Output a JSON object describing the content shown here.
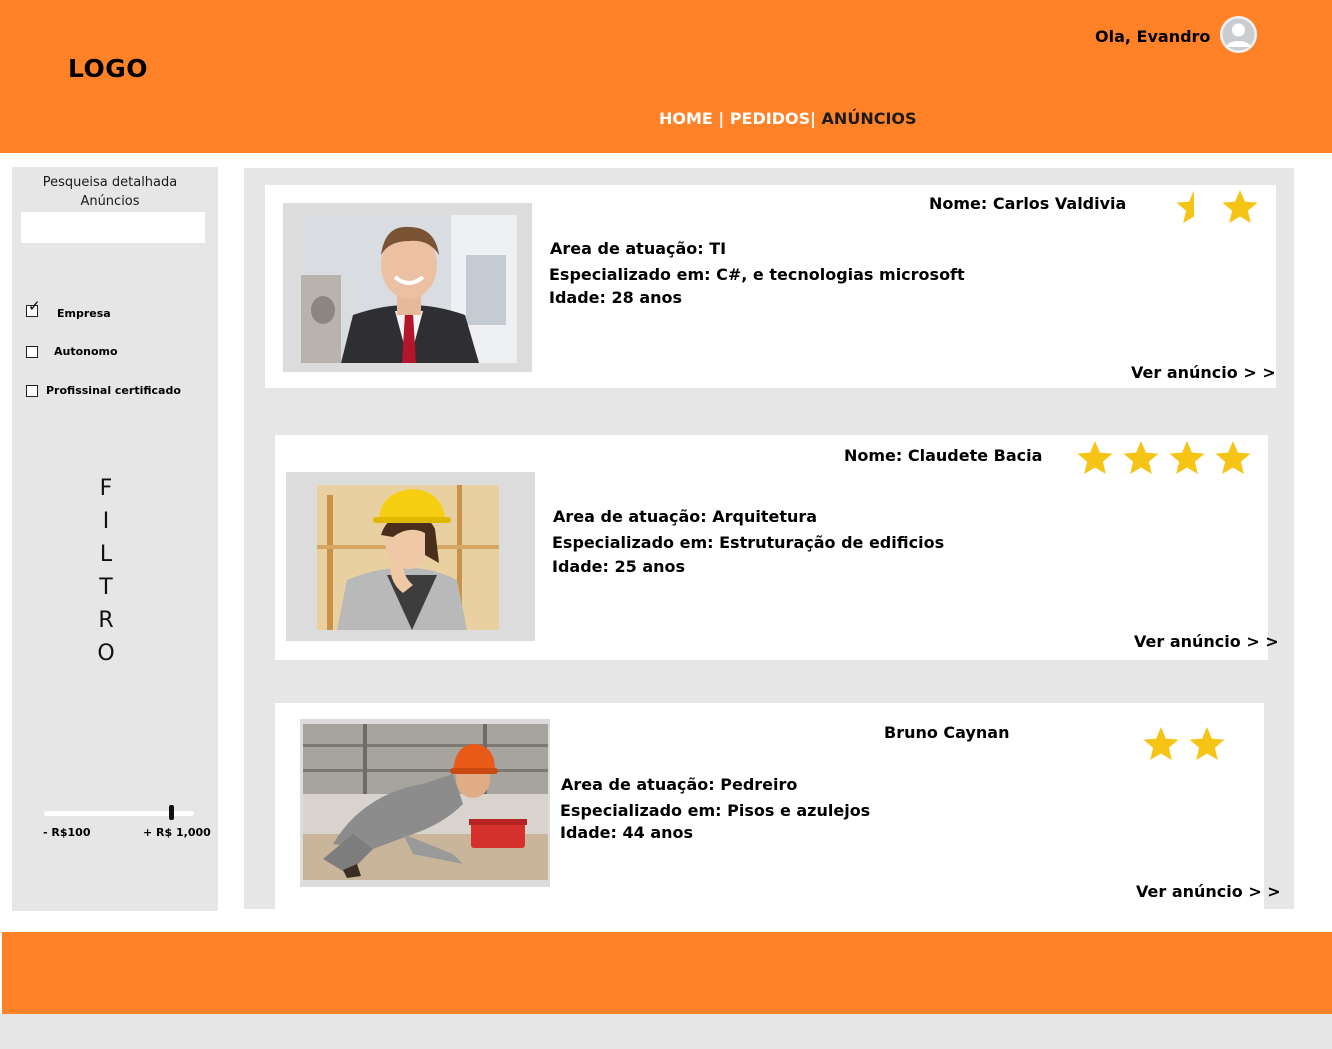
{
  "colors": {
    "brand": "#ff8228",
    "panel": "#e6e6e6",
    "star": "#f6c415",
    "active_nav": "#1a1a1a"
  },
  "header": {
    "logo": "LOGO",
    "greeting": "Ola, Evandro",
    "nav": {
      "home": "HOME",
      "sep1": " | ",
      "pedidos": "PEDIDOS",
      "sep2": "| ",
      "anuncios": "ANÚNCIOS",
      "active": "anuncios"
    }
  },
  "sidebar": {
    "title_line1": "Pesqueisa detalhada",
    "title_line2": "Anúncios",
    "search_value": "",
    "checkboxes": [
      {
        "label": "Empresa",
        "checked": true
      },
      {
        "label": "Autonomo",
        "checked": false
      },
      {
        "label": "Profissinal certificado",
        "checked": false
      }
    ],
    "filter_letters": [
      "F",
      "I",
      "L",
      "T",
      "R",
      "O"
    ],
    "price_min": "- R$100",
    "price_max": "+ R$ 1,000",
    "slider_value": 0.85
  },
  "listings": [
    {
      "name_label": "Nome:",
      "name": "Carlos Valdivia",
      "area_label": "Area de atuação:",
      "area": "TI",
      "spec_label": "Especializado em:",
      "spec": "C#, e tecnologias microsoft",
      "age_label": "Idade:",
      "age": "28 anos",
      "rating": 1.5,
      "link": "Ver anúncio > >",
      "photo_icon": "businessman-photo"
    },
    {
      "name_label": "Nome:",
      "name": "Claudete Bacia",
      "area_label": "Area de atuação:",
      "area": "Arquitetura",
      "spec_label": "Especializado em:",
      "spec": "Estruturação de edificios",
      "age_label": "Idade:",
      "age": "25 anos",
      "rating": 4,
      "link": "Ver anúncio > >",
      "photo_icon": "architect-photo"
    },
    {
      "name_label": "",
      "name": "Bruno Caynan",
      "area_label": "Area de atuação:",
      "area": "Pedreiro",
      "spec_label": "Especializado em:",
      "spec": "Pisos e azulejos",
      "age_label": "Idade:",
      "age": "44 anos",
      "rating": 2,
      "link": "Ver anúncio > >",
      "photo_icon": "bricklayer-photo"
    }
  ]
}
